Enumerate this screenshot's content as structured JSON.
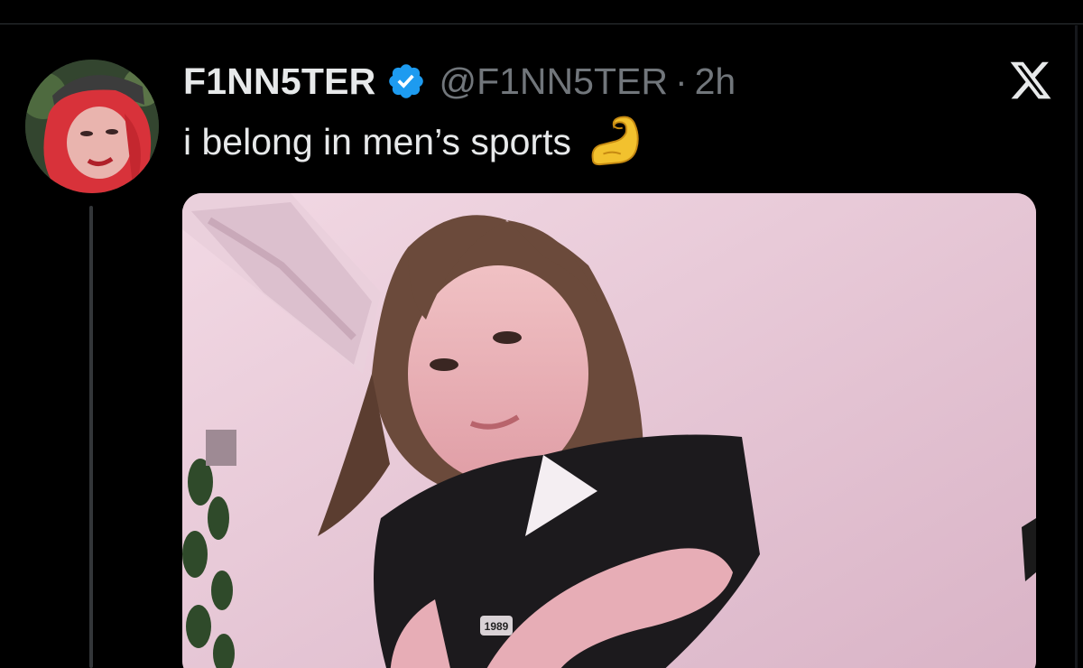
{
  "post": {
    "display_name": "F1NN5TER",
    "handle": "@F1NN5TER",
    "separator": "·",
    "time": "2h",
    "text": "i belong in men’s sports",
    "emoji": "flexed-biceps-icon",
    "verified": true
  },
  "platform": {
    "logo": "x-logo-icon"
  },
  "colors": {
    "background": "#000000",
    "text_primary": "#e7e9ea",
    "text_secondary": "#71767b",
    "verified_blue": "#1d9bf0",
    "divider": "#2f3336"
  },
  "media": {
    "type": "photo",
    "overlay_text": "1989"
  }
}
